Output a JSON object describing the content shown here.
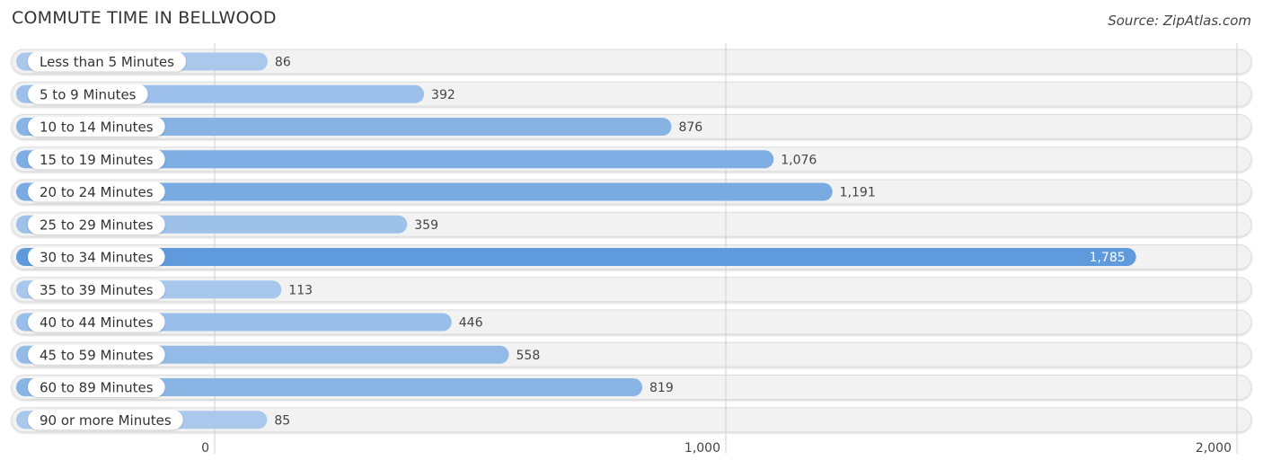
{
  "header": {
    "title": "COMMUTE TIME IN BELLWOOD",
    "source": "Source: ZipAtlas.com"
  },
  "chart_data": {
    "type": "bar",
    "orientation": "horizontal",
    "title": "COMMUTE TIME IN BELLWOOD",
    "xlabel": "",
    "ylabel": "",
    "xlim": [
      0,
      2000
    ],
    "grid": true,
    "categories": [
      "Less than 5 Minutes",
      "5 to 9 Minutes",
      "10 to 14 Minutes",
      "15 to 19 Minutes",
      "20 to 24 Minutes",
      "25 to 29 Minutes",
      "30 to 34 Minutes",
      "35 to 39 Minutes",
      "40 to 44 Minutes",
      "45 to 59 Minutes",
      "60 to 89 Minutes",
      "90 or more Minutes"
    ],
    "values": [
      86,
      392,
      876,
      1076,
      1191,
      359,
      1785,
      113,
      446,
      558,
      819,
      85
    ],
    "value_labels": [
      "86",
      "392",
      "876",
      "1,076",
      "1,191",
      "359",
      "1,785",
      "113",
      "446",
      "558",
      "819",
      "85"
    ],
    "x_ticks": [
      0,
      1000,
      2000
    ],
    "x_tick_labels": [
      "0",
      "1,000",
      "2,000"
    ],
    "colors": {
      "bar_min": "#a9c8ec",
      "bar_max": "#5f9bdc",
      "track": "#f2f2f2",
      "track_border": "#dddddd",
      "grid": "#d0d0d0",
      "label_pill": "#ffffff"
    }
  }
}
